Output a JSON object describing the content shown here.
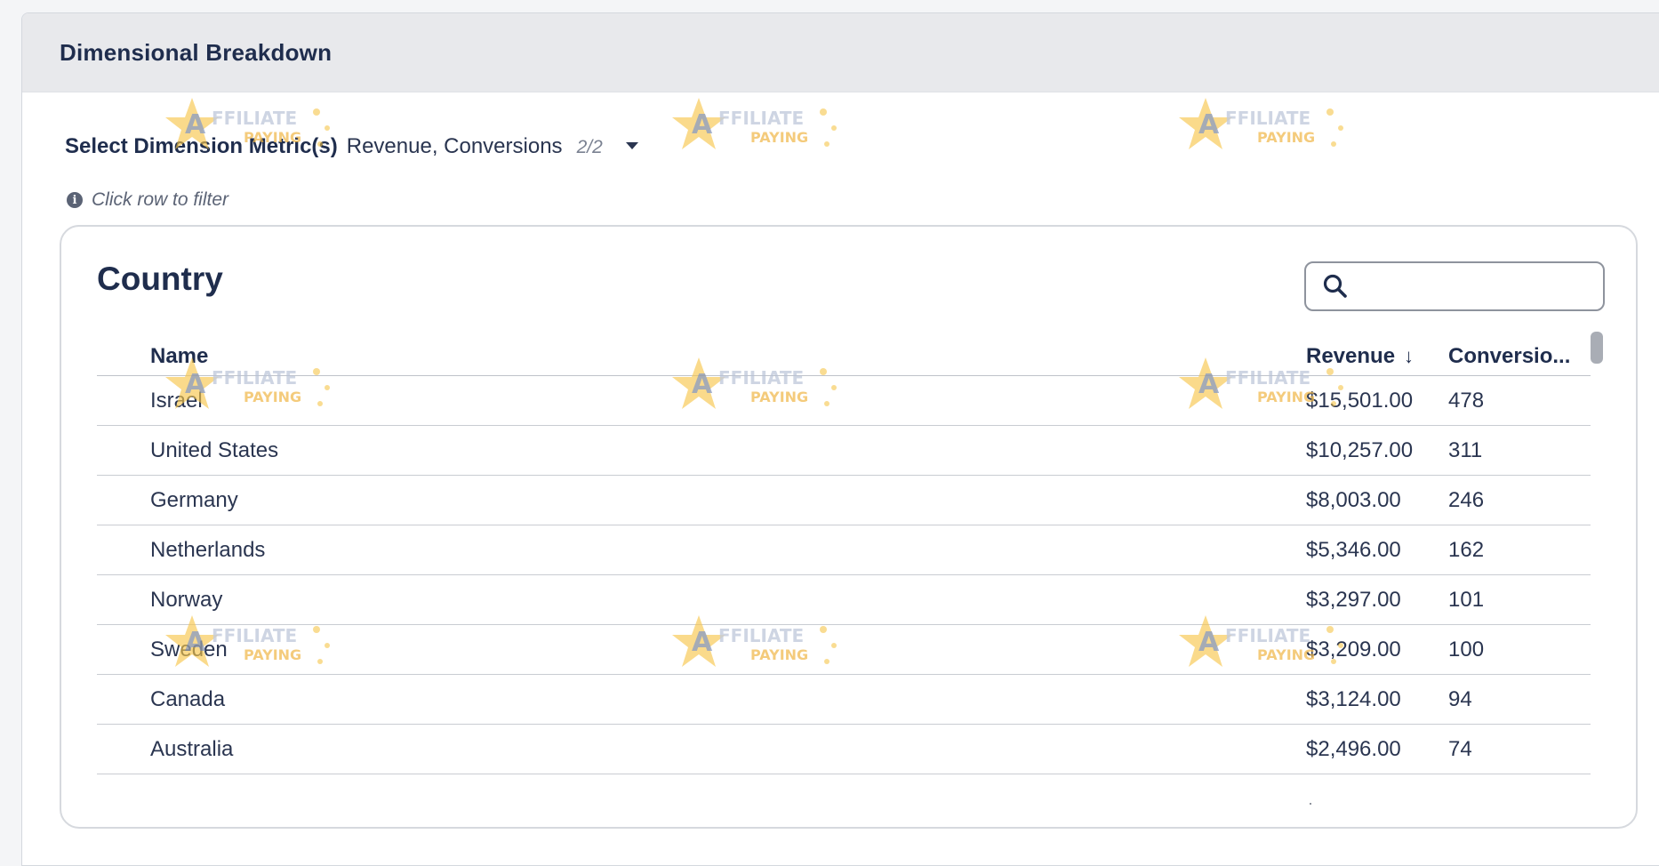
{
  "panel": {
    "title": "Dimensional Breakdown"
  },
  "metrics": {
    "label": "Select Dimension Metric(s)",
    "value": "Revenue, Conversions",
    "count": "2/2"
  },
  "hint": "Click row to filter",
  "card": {
    "title": "Country",
    "search": {
      "value": "",
      "placeholder": ""
    }
  },
  "table": {
    "headers": {
      "name": "Name",
      "revenue": "Revenue",
      "conversions": "Conversio..."
    },
    "sort": {
      "column": "revenue",
      "direction": "descending"
    },
    "rows": [
      {
        "name": "Israel",
        "revenue": "$15,501.00",
        "conversions": "478"
      },
      {
        "name": "United States",
        "revenue": "$10,257.00",
        "conversions": "311"
      },
      {
        "name": "Germany",
        "revenue": "$8,003.00",
        "conversions": "246"
      },
      {
        "name": "Netherlands",
        "revenue": "$5,346.00",
        "conversions": "162"
      },
      {
        "name": "Norway",
        "revenue": "$3,297.00",
        "conversions": "101"
      },
      {
        "name": "Sweden",
        "revenue": "$3,209.00",
        "conversions": "100"
      },
      {
        "name": "Canada",
        "revenue": "$3,124.00",
        "conversions": "94"
      },
      {
        "name": "Australia",
        "revenue": "$2,496.00",
        "conversions": "74"
      }
    ]
  },
  "watermark": {
    "line1": "AFFILIATE",
    "line2": "PAYING"
  },
  "colors": {
    "header_bg": "#e8e9ec",
    "text": "#1f2d4d",
    "border": "#d6d9de"
  }
}
